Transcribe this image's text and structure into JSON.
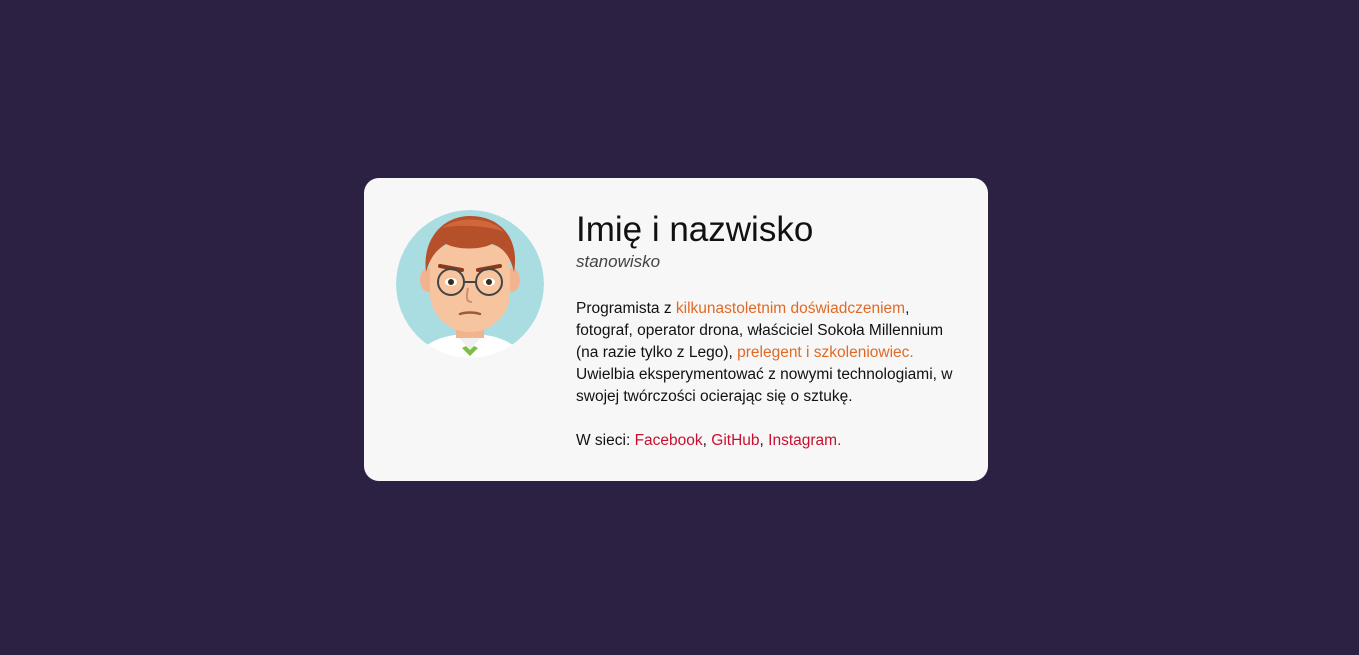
{
  "profile": {
    "name": "Imię i nazwisko",
    "role": "stanowisko",
    "avatar_icon": "developer-avatar-icon",
    "bio": {
      "t1": "Programista z ",
      "link_experience": "kilkunastoletnim doświadczeniem",
      "t2": ", fotograf, operator drona, właściciel Sokoła Millennium (na razie tylko z Lego), ",
      "link_speaker": "prelegent i szkoleniowiec.",
      "t3": " Uwielbia eksperymentować z nowymi technologiami, w swojej twórczości ocierając się o sztukę."
    },
    "social": {
      "prefix": "W sieci: ",
      "facebook": "Facebook",
      "sep1": ", ",
      "github": "GitHub",
      "sep2": ", ",
      "instagram": "Instagram",
      "suffix": "."
    }
  },
  "colors": {
    "background": "#2c2142",
    "card": "#f7f7f7",
    "accent_orange": "#e06a25",
    "accent_red": "#c8102e"
  }
}
